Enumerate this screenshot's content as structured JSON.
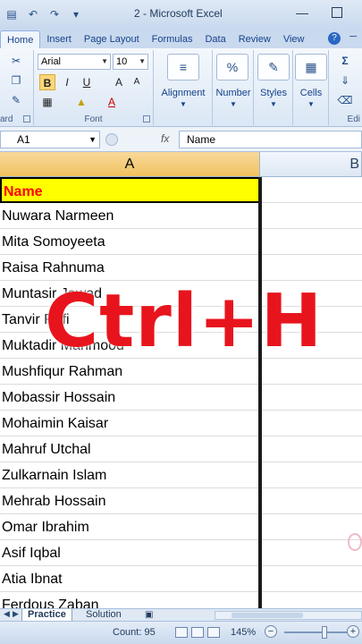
{
  "window": {
    "title": "2 - Microsoft Excel"
  },
  "ribbon_tabs": [
    "Home",
    "Insert",
    "Page Layout",
    "Formulas",
    "Data",
    "Review",
    "View"
  ],
  "ribbon": {
    "font_name": "Arial",
    "font_size": "10",
    "font_group_label": "Font",
    "clipboard_group_label": "ard",
    "alignment_label": "Alignment",
    "number_label": "Number",
    "styles_label": "Styles",
    "cells_label": "Cells",
    "editing_label": "Edi",
    "bold": "B",
    "italic": "I",
    "underline": "U",
    "percent": "%",
    "grow_font": "A",
    "font_color": "A"
  },
  "formula_bar": {
    "name_box": "A1",
    "fx": "fx",
    "formula": "Name"
  },
  "columns": [
    "A",
    "B"
  ],
  "rows": [
    "Name",
    "Nuwara Narmeen",
    "Mita Somoyeeta",
    "Raisa Rahnuma",
    "Muntasir Jawad",
    "Tanvir Rafi",
    "Muktadir Mahmood",
    "Mushfiqur Rahman",
    "Mobassir Hossain",
    "Mohaimin Kaisar",
    "Mahruf Utchal",
    "Zulkarnain Islam",
    "Mehrab Hossain",
    "Omar Ibrahim",
    "Asif Iqbal",
    "Atia Ibnat",
    "Ferdous Zaban"
  ],
  "overlay_text": "Ctrl+H",
  "sheets": [
    "Practice",
    "Solution"
  ],
  "status": {
    "count": "Count: 95",
    "zoom": "145%"
  },
  "colors": {
    "header_fill": "#ffff00",
    "header_text": "#ff0000",
    "overlay": "#e8141d"
  }
}
